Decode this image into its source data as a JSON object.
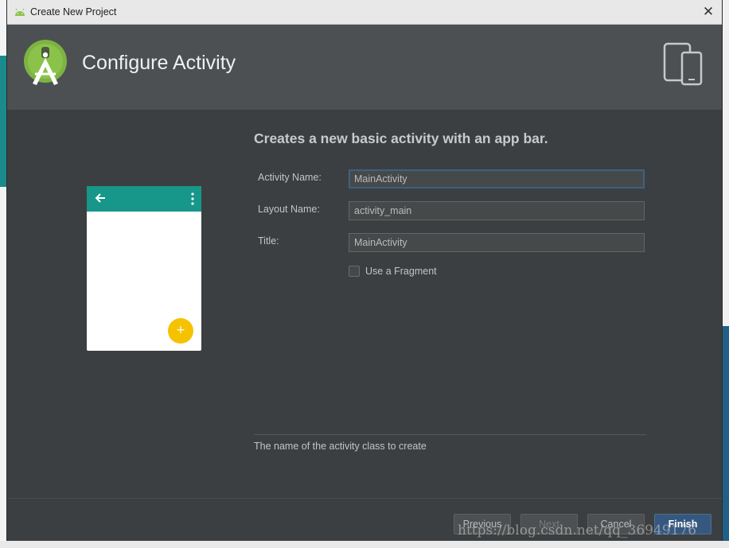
{
  "window": {
    "title": "Create New Project",
    "close_glyph": "✕"
  },
  "header": {
    "heading": "Configure Activity",
    "logo_icon": "android-studio-logo-icon",
    "devices_icon": "phone-tablet-icon"
  },
  "preview": {
    "back_icon": "arrow-back-icon",
    "menu_icon": "overflow-menu-icon",
    "fab_glyph": "+",
    "appbar_color": "#16978a",
    "fab_color": "#f5c200"
  },
  "form": {
    "description": "Creates a new basic activity with an app bar.",
    "activity_name_label": "Activity Name:",
    "activity_name_value": "MainActivity",
    "layout_name_label": "Layout Name:",
    "layout_name_value": "activity_main",
    "title_label": "Title:",
    "title_value": "MainActivity",
    "use_fragment_label": "Use a Fragment",
    "use_fragment_checked": false
  },
  "hint": "The name of the activity class to create",
  "buttons": {
    "previous": "Previous",
    "next": "Next",
    "cancel": "Cancel",
    "finish": "Finish"
  },
  "watermark": "https://blog.csdn.net/qq_36949176",
  "colors": {
    "dialog_bg": "#3c3f41",
    "header_bg": "#4c5052",
    "primary_button": "#365880"
  }
}
